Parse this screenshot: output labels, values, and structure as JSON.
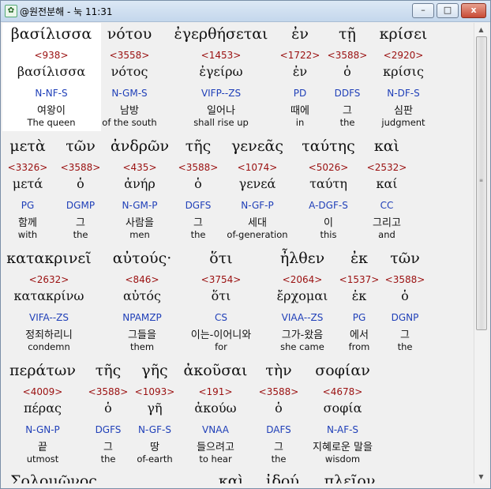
{
  "window": {
    "title": "@원전분해 - 눅 11:31",
    "controls": {
      "minimize": "–",
      "maximize": "□",
      "close": "x"
    }
  },
  "rows": [
    {
      "words": [
        {
          "greek": "βασίλισσα",
          "strong": "<938>",
          "lemma": "βασίλισσα",
          "morph": "N-NF-S",
          "korean": "여왕이",
          "english": "The queen"
        },
        {
          "greek": "νότου",
          "strong": "<3558>",
          "lemma": "νότος",
          "morph": "N-GM-S",
          "korean": "남방",
          "english": "of the south"
        },
        {
          "greek": "ἐγερθήσεται",
          "strong": "<1453>",
          "lemma": "ἐγείρω",
          "morph": "VIFP--ZS",
          "korean": "일어나",
          "english": "shall rise up"
        },
        {
          "greek": "ἐν",
          "strong": "<1722>",
          "lemma": "ἐν",
          "morph": "PD",
          "korean": "때에",
          "english": "in"
        },
        {
          "greek": "τῇ",
          "strong": "<3588>",
          "lemma": "ὁ",
          "morph": "DDFS",
          "korean": "그",
          "english": "the"
        },
        {
          "greek": "κρίσει",
          "strong": "<2920>",
          "lemma": "κρίσις",
          "morph": "N-DF-S",
          "korean": "심판",
          "english": "judgment"
        }
      ]
    },
    {
      "words": [
        {
          "greek": "μετὰ",
          "strong": "<3326>",
          "lemma": "μετά",
          "morph": "PG",
          "korean": "함께",
          "english": "with"
        },
        {
          "greek": "τῶν",
          "strong": "<3588>",
          "lemma": "ὁ",
          "morph": "DGMP",
          "korean": "그",
          "english": "the"
        },
        {
          "greek": "ἀνδρῶν",
          "strong": "<435>",
          "lemma": "ἀνήρ",
          "morph": "N-GM-P",
          "korean": "사람을",
          "english": "men"
        },
        {
          "greek": "τῆς",
          "strong": "<3588>",
          "lemma": "ὁ",
          "morph": "DGFS",
          "korean": "그",
          "english": "the"
        },
        {
          "greek": "γενεᾶς",
          "strong": "<1074>",
          "lemma": "γενεά",
          "morph": "N-GF-P",
          "korean": "세대",
          "english": "of-generation"
        },
        {
          "greek": "ταύτης",
          "strong": "<5026>",
          "lemma": "ταύτη",
          "morph": "A-DGF-S",
          "korean": "이",
          "english": "this"
        },
        {
          "greek": "καὶ",
          "strong": "<2532>",
          "lemma": "καί",
          "morph": "CC",
          "korean": "그리고",
          "english": "and"
        }
      ]
    },
    {
      "words": [
        {
          "greek": "κατακρινεῖ",
          "strong": "<2632>",
          "lemma": "κατακρίνω",
          "morph": "VIFA--ZS",
          "korean": "정죄하리니",
          "english": "condemn"
        },
        {
          "greek": "αὐτούς·",
          "strong": "<846>",
          "lemma": "αὐτός",
          "morph": "NPAMZP",
          "korean": "그들을",
          "english": "them"
        },
        {
          "greek": "ὅτι",
          "strong": "<3754>",
          "lemma": "ὅτι",
          "morph": "CS",
          "korean": "이는-이어니와",
          "english": "for"
        },
        {
          "greek": "ἦλθεν",
          "strong": "<2064>",
          "lemma": "ἔρχομαι",
          "morph": "VIAA--ZS",
          "korean": "그가-왔음",
          "english": "she came"
        },
        {
          "greek": "ἐκ",
          "strong": "<1537>",
          "lemma": "ἐκ",
          "morph": "PG",
          "korean": "에서",
          "english": "from"
        },
        {
          "greek": "τῶν",
          "strong": "<3588>",
          "lemma": "ὁ",
          "morph": "DGNP",
          "korean": "그",
          "english": "the"
        }
      ]
    },
    {
      "words": [
        {
          "greek": "περάτων",
          "strong": "<4009>",
          "lemma": "πέρας",
          "morph": "N-GN-P",
          "korean": "끝",
          "english": "utmost"
        },
        {
          "greek": "τῆς",
          "strong": "<3588>",
          "lemma": "ὁ",
          "morph": "DGFS",
          "korean": "그",
          "english": "the"
        },
        {
          "greek": "γῆς",
          "strong": "<1093>",
          "lemma": "γῆ",
          "morph": "N-GF-S",
          "korean": "땅",
          "english": "of-earth"
        },
        {
          "greek": "ἀκοῦσαι",
          "strong": "<191>",
          "lemma": "ἀκούω",
          "morph": "VNAA",
          "korean": "들으려고",
          "english": "to hear"
        },
        {
          "greek": "τὴν",
          "strong": "<3588>",
          "lemma": "ὁ",
          "morph": "DAFS",
          "korean": "그",
          "english": "the"
        },
        {
          "greek": "σοφίαν",
          "strong": "<4678>",
          "lemma": "σοφία",
          "morph": "N-AF-S",
          "korean": "지혜로운 말을",
          "english": "wisdom"
        }
      ]
    }
  ],
  "partial_row": [
    "Σολομῶνος",
    "καὶ",
    "ἰδού",
    "πλεῖον"
  ],
  "colors": {
    "strong": "#9a1010",
    "morph": "#1f3fb8",
    "selection": "#ffffff"
  }
}
